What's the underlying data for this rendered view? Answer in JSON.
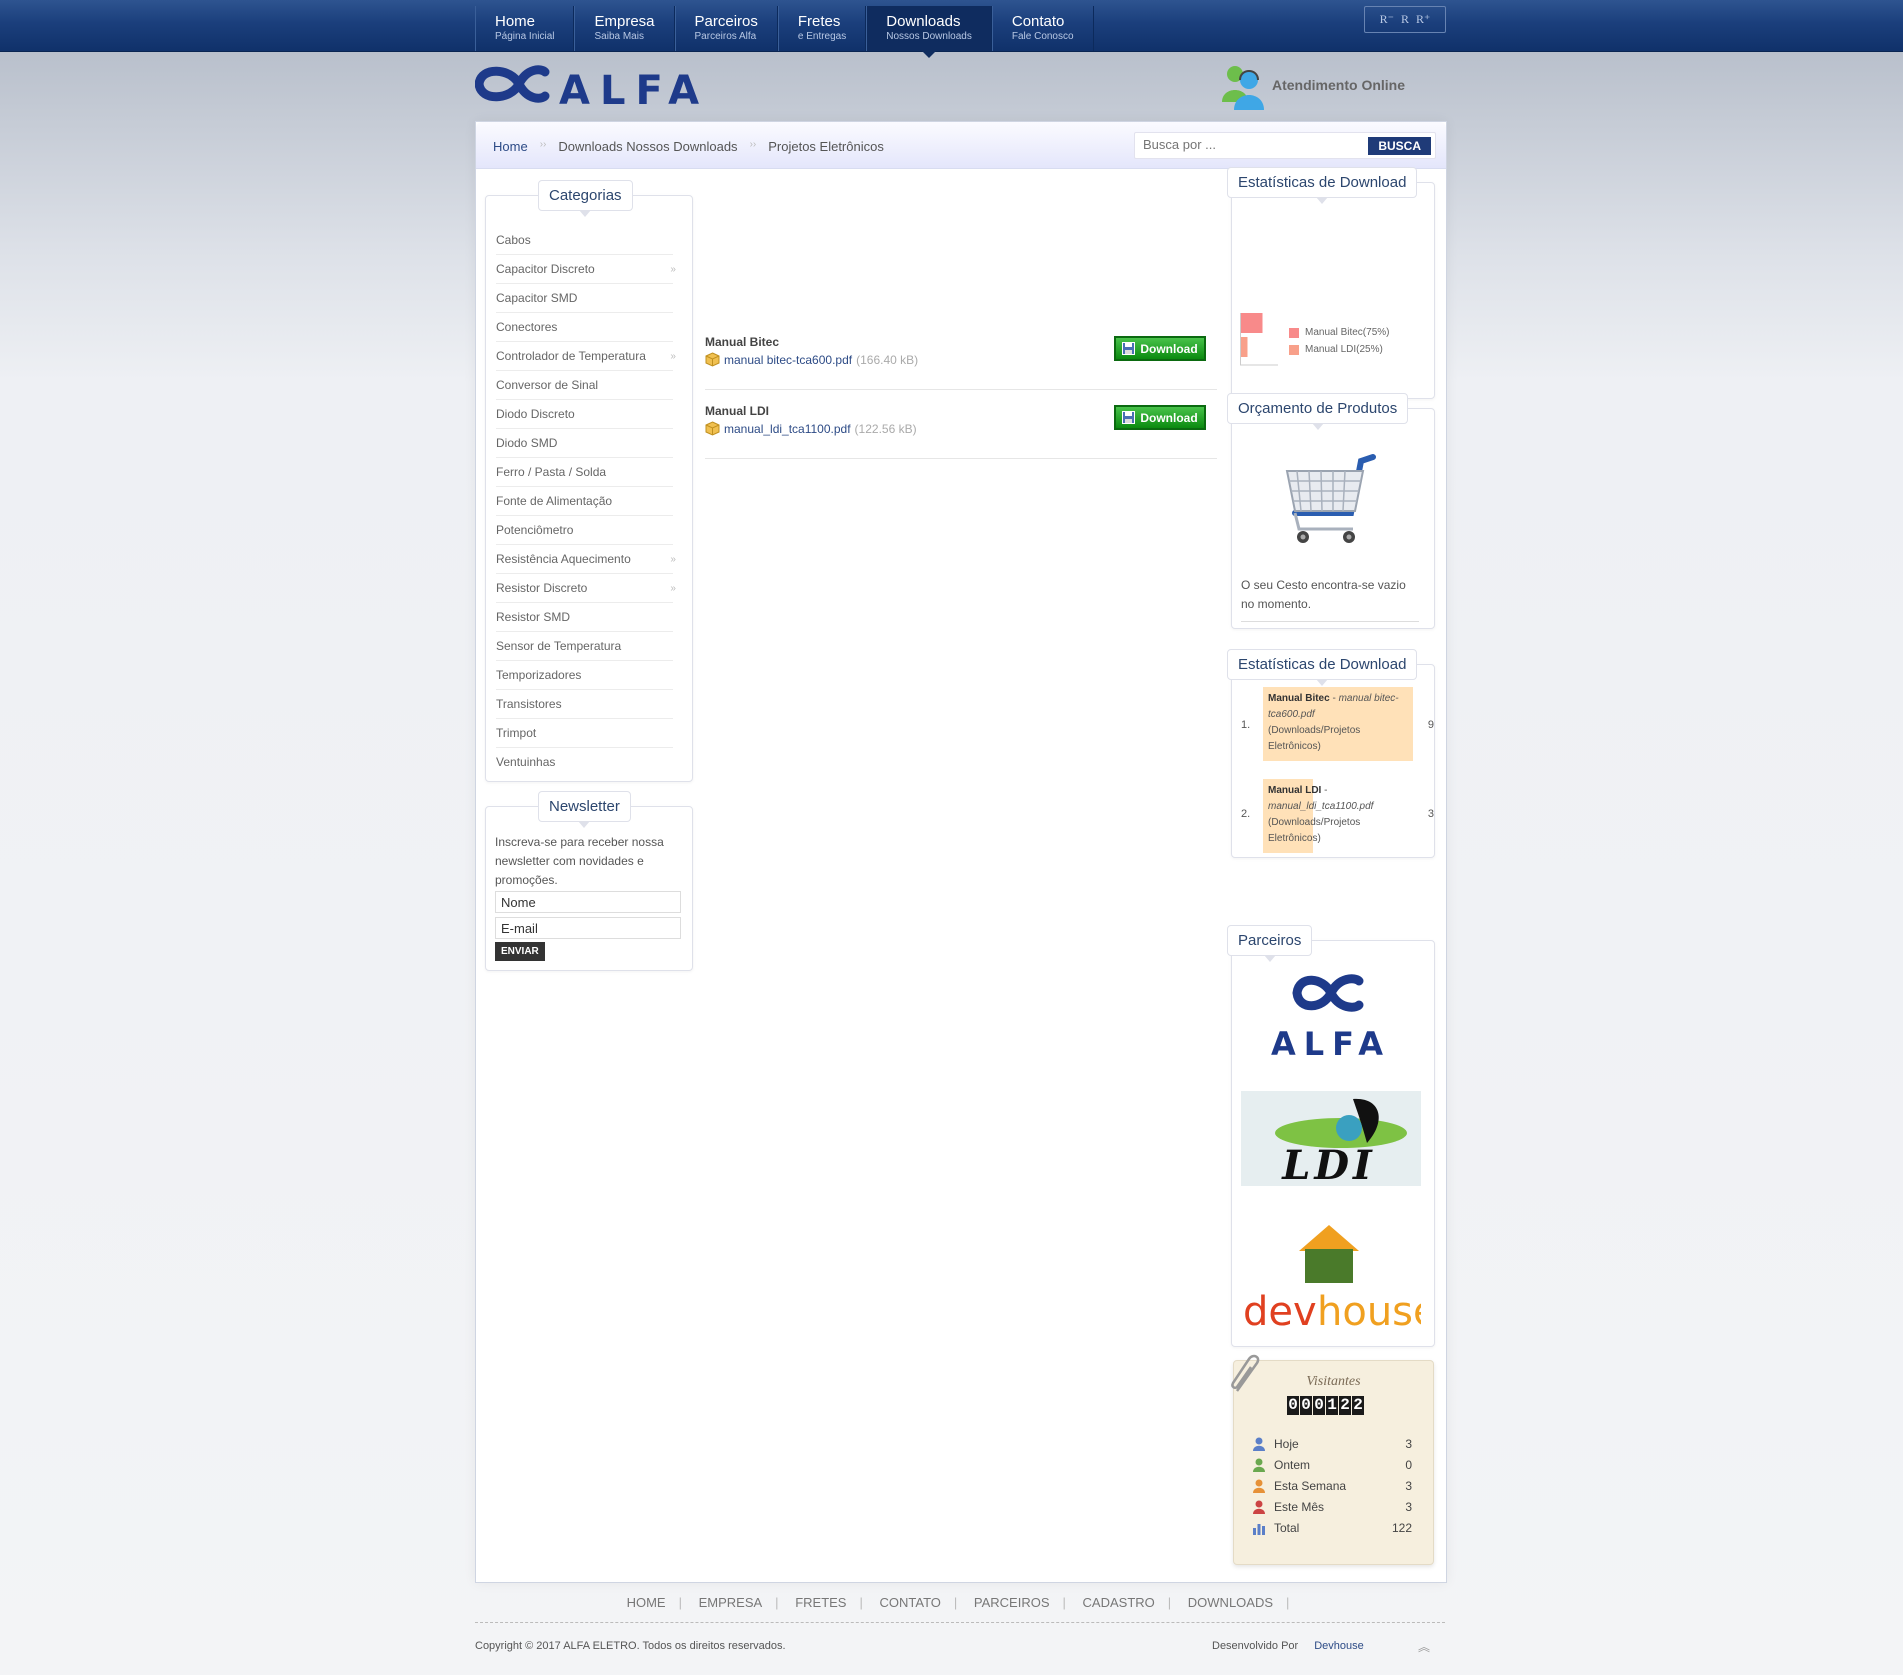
{
  "nav": {
    "items": [
      {
        "title": "Home",
        "sub": "Página Inicial"
      },
      {
        "title": "Empresa",
        "sub": "Saiba Mais"
      },
      {
        "title": "Parceiros",
        "sub": "Parceiros Alfa"
      },
      {
        "title": "Fretes",
        "sub": "e Entregas"
      },
      {
        "title": "Downloads",
        "sub": "Nossos Downloads"
      },
      {
        "title": "Contato",
        "sub": "Fale Conosco"
      }
    ],
    "font_controls": [
      "R⁻",
      "R",
      "R⁺"
    ]
  },
  "brand": {
    "logo_text": "ALFA",
    "online_label": "Atendimento Online"
  },
  "breadcrumb": {
    "home": "Home",
    "level1": "Downloads Nossos Downloads",
    "level2": "Projetos Eletrônicos"
  },
  "search": {
    "placeholder": "Busca por ...",
    "button": "BUSCA"
  },
  "categories": {
    "title": "Categorias",
    "items": [
      {
        "label": "Cabos",
        "arrow": ""
      },
      {
        "label": "Capacitor Discreto",
        "arrow": "››"
      },
      {
        "label": "Capacitor SMD",
        "arrow": ""
      },
      {
        "label": "Conectores",
        "arrow": ""
      },
      {
        "label": "Controlador de Temperatura",
        "arrow": "››"
      },
      {
        "label": "Conversor de Sinal",
        "arrow": ""
      },
      {
        "label": "Diodo Discreto",
        "arrow": ""
      },
      {
        "label": "Diodo SMD",
        "arrow": ""
      },
      {
        "label": "Ferro / Pasta / Solda",
        "arrow": ""
      },
      {
        "label": "Fonte de Alimentação",
        "arrow": ""
      },
      {
        "label": "Potenciômetro",
        "arrow": ""
      },
      {
        "label": "Resistência Aquecimento",
        "arrow": "››"
      },
      {
        "label": "Resistor Discreto",
        "arrow": "››"
      },
      {
        "label": "Resistor SMD",
        "arrow": ""
      },
      {
        "label": "Sensor de Temperatura",
        "arrow": ""
      },
      {
        "label": "Temporizadores",
        "arrow": ""
      },
      {
        "label": "Transistores",
        "arrow": ""
      },
      {
        "label": "Trimpot",
        "arrow": ""
      },
      {
        "label": "Ventuinhas",
        "arrow": ""
      }
    ]
  },
  "newsletter": {
    "title": "Newsletter",
    "text": "Inscreva-se para receber nossa newsletter com novidades e promoções.",
    "name_value": "Nome",
    "email_value": "E-mail",
    "button": "ENVIAR"
  },
  "downloads": [
    {
      "title": "Manual Bitec",
      "file": "manual bitec-tca600.pdf",
      "size": "(166.40 kB)",
      "button": "Download"
    },
    {
      "title": "Manual LDI",
      "file": "manual_ldi_tca1100.pdf",
      "size": "(122.56 kB)",
      "button": "Download"
    }
  ],
  "stats_chart": {
    "title": "Estatísticas de Download",
    "legend": [
      "Manual Bitec(75%)",
      "Manual LDI(25%)"
    ]
  },
  "chart_data": {
    "type": "bar",
    "categories": [
      "Manual Bitec",
      "Manual LDI"
    ],
    "values": [
      75,
      25
    ],
    "ylim": [
      0,
      100
    ],
    "colors": [
      "#f88a8a",
      "#f8a08a"
    ],
    "legend_position": "right"
  },
  "quote": {
    "title": "Orçamento de Produtos",
    "empty_text": "O seu Cesto encontra-se vazio no momento."
  },
  "stats_list": {
    "title": "Estatísticas de Download",
    "items": [
      {
        "rank": "1.",
        "name": "Manual Bitec",
        "dash": " - ",
        "file": "manual bitec-tca600.pdf",
        "path": "(Downloads/Projetos Eletrônicos)",
        "count": "9"
      },
      {
        "rank": "2.",
        "name": "Manual LDI",
        "dash": " - ",
        "file": "manual_ldi_tca1100.pdf",
        "path": "(Downloads/Projetos Eletrônicos)",
        "count": "3"
      }
    ]
  },
  "partners": {
    "title": "Parceiros",
    "alfa": "ALFA",
    "ldi": "LDI",
    "dev": "dev",
    "house": "house"
  },
  "visitors": {
    "title": "Visitantes",
    "counter": [
      "0",
      "0",
      "0",
      "1",
      "2",
      "2"
    ],
    "rows": [
      {
        "label": "Hoje",
        "value": "3",
        "color": "#5b7fc8"
      },
      {
        "label": "Ontem",
        "value": "0",
        "color": "#6aa84f"
      },
      {
        "label": "Esta Semana",
        "value": "3",
        "color": "#e69138"
      },
      {
        "label": "Este Mês",
        "value": "3",
        "color": "#cc4444"
      },
      {
        "label": "Total",
        "value": "122",
        "color": "#5b7fc8"
      }
    ]
  },
  "footer": {
    "links": [
      "HOME",
      "EMPRESA",
      "FRETES",
      "CONTATO",
      "PARCEIROS",
      "CADASTRO",
      "DOWNLOADS"
    ],
    "copyright": "Copyright © 2017 ALFA ELETRO. Todos os direitos reservados.",
    "dev_label": "Desenvolvido Por",
    "dev_link": "Devhouse"
  }
}
